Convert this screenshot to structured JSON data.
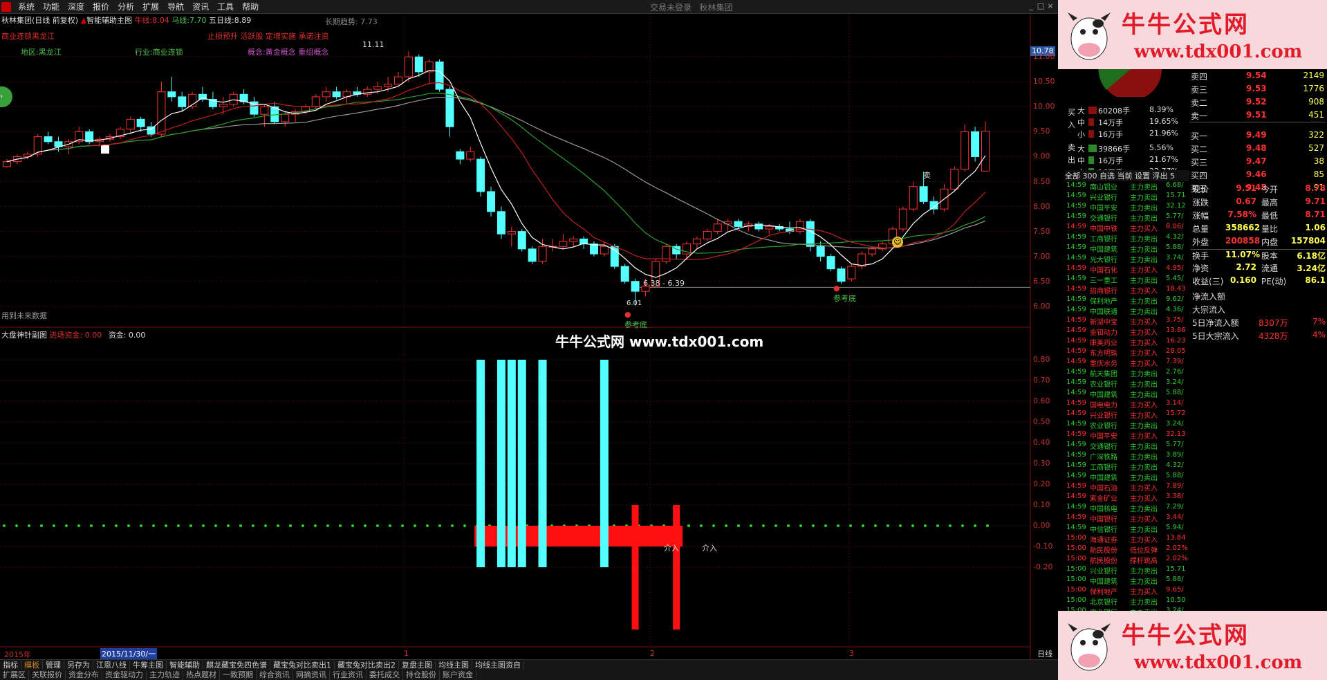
{
  "menu": [
    "系统",
    "功能",
    "深度",
    "报价",
    "分析",
    "扩展",
    "导航",
    "资讯",
    "工具",
    "帮助"
  ],
  "window": {
    "title": "交易未登录",
    "company": "秋林集团"
  },
  "main_header": {
    "stock": "秋林集团(日线 前复权)",
    "indicator": "智能辅助主图",
    "niu_label": "牛线:",
    "niu_val": "8.04",
    "ma_label": "马线:",
    "ma_val": "7.70",
    "wr_label": "五日线:",
    "wr_val": "8.89",
    "trend_label": "长期趋势:",
    "trend_val": "7.73"
  },
  "tags": {
    "line2_left": "商业连锁黑龙江",
    "line2_right": "止损预升 活跃股 定增实施 承诺注资",
    "region": "地区:黑龙江",
    "industry": "行业:商业连锁",
    "concept": "概念:黄金概念 重组概念"
  },
  "annotations": {
    "top": "11.11",
    "low": "6.01",
    "range": "6.38 - 6.39",
    "ref1": "参考底",
    "ref2": "参考底",
    "sell": "卖",
    "future": "用到未来数据",
    "jieru1": "介入",
    "jieru2": "介入"
  },
  "price_axis": [
    "11.00",
    "10.50",
    "10.00",
    "9.50",
    "9.00",
    "8.50",
    "8.00",
    "7.50",
    "7.00",
    "6.50",
    "6.00"
  ],
  "price_tag": "10.78",
  "sub_header": {
    "title": "大盘神针副图",
    "entry": "进场资金: 0.00",
    "fund": "资金: 0.00"
  },
  "sub_axis": [
    "0.80",
    "0.70",
    "0.60",
    "0.50",
    "0.40",
    "0.30",
    "0.20",
    "0.10",
    "0.00",
    "-0.10",
    "-0.20"
  ],
  "date_bar": {
    "year": "2015年",
    "date": "2015/11/30/一",
    "m1": "1",
    "m2": "2",
    "m3": "3",
    "unit": "日线"
  },
  "watermark": "牛牛公式网 www.tdx001.com",
  "ad": {
    "line1": "牛牛公式网",
    "line2": "www.tdx001.com"
  },
  "tabs1": [
    "指标",
    "模板",
    "管理",
    "另存为",
    "江恩八线",
    "牛筹主图",
    "智能辅助",
    "麒龙藏宝免四色谱",
    "藏宝兔对比卖出1",
    "藏宝兔对比卖出2",
    "复盘主图",
    "均线主图",
    "均线主图资自"
  ],
  "tabs2": [
    "扩展区",
    "关联报价",
    "资金分布",
    "资金驱动力",
    "主力轨迹",
    "热点题材",
    "一致预期",
    "综合资讯",
    "网摘资讯",
    "行业资讯",
    "委托成交",
    "持仓股份",
    "账户资金"
  ],
  "orderbook": {
    "sell": [
      {
        "l": "卖四",
        "p": "9.54",
        "v": "2149"
      },
      {
        "l": "卖三",
        "p": "9.53",
        "v": "1776"
      },
      {
        "l": "卖二",
        "p": "9.52",
        "v": "908"
      },
      {
        "l": "卖一",
        "p": "9.51",
        "v": "451"
      }
    ],
    "buy": [
      {
        "l": "买一",
        "p": "9.49",
        "v": "322"
      },
      {
        "l": "买二",
        "p": "9.48",
        "v": "527"
      },
      {
        "l": "买三",
        "p": "9.47",
        "v": "38"
      },
      {
        "l": "买四",
        "p": "9.46",
        "v": "85"
      },
      {
        "l": "买五",
        "p": "9.45",
        "v": "91"
      }
    ]
  },
  "flow": {
    "buy": [
      {
        "s": "大",
        "v": "60208手",
        "p": "8.39%"
      },
      {
        "s": "中",
        "v": "14万手",
        "p": "19.65%"
      },
      {
        "s": "小",
        "v": "16万手",
        "p": "21.96%"
      }
    ],
    "sell": [
      {
        "s": "大",
        "v": "39866手",
        "p": "5.56%"
      },
      {
        "s": "中",
        "v": "16万手",
        "p": "21.67%"
      },
      {
        "s": "小",
        "v": "16万手",
        "p": "22.77%"
      }
    ],
    "buy_lbl": "买 入",
    "sell_lbl": "卖 出",
    "tabs": "全部  300  自选  当前  设置  浮出  5"
  },
  "quote": [
    [
      "现价",
      "9.51",
      "今开",
      "8.78"
    ],
    [
      "涨跌",
      "0.67",
      "最高",
      "9.71"
    ],
    [
      "涨幅",
      "7.58%",
      "最低",
      "8.71"
    ],
    [
      "总量",
      "358662",
      "量比",
      "1.06"
    ],
    [
      "外盘",
      "200858",
      "内盘",
      "157804"
    ],
    [
      "换手",
      "11.07%",
      "股本",
      "6.18亿"
    ],
    [
      "净资",
      "2.72",
      "流通",
      "3.24亿"
    ],
    [
      "收益(三)",
      "0.160",
      "PE(动)",
      "86.1"
    ]
  ],
  "extras": {
    "l1": "净流入额",
    "l2": "大宗流入",
    "l3": "5日净流入额",
    "v3": "8307万",
    "p3": "7%",
    "l4": "5日大宗流入",
    "v4": "4328万",
    "p4": "4%"
  },
  "ticks": [
    [
      "14:59",
      "南山铝业",
      "主力卖出",
      "6.68/",
      "g"
    ],
    [
      "14:59",
      "兴业银行",
      "主力卖出",
      "15.71",
      "g"
    ],
    [
      "14:59",
      "中国平安",
      "主力卖出",
      "32.12",
      "g"
    ],
    [
      "14:59",
      "交通银行",
      "主力卖出",
      "5.77/",
      "g"
    ],
    [
      "14:59",
      "中国中铁",
      "主力买入",
      "8.06/",
      "r"
    ],
    [
      "14:59",
      "工商银行",
      "主力卖出",
      "4.32/",
      "g"
    ],
    [
      "14:59",
      "中国建筑",
      "主力卖出",
      "5.88/",
      "g"
    ],
    [
      "14:59",
      "光大银行",
      "主力卖出",
      "3.74/",
      "g"
    ],
    [
      "14:59",
      "中国石化",
      "主力买入",
      "4.95/",
      "r"
    ],
    [
      "14:59",
      "三一重工",
      "主力卖出",
      "5.45/",
      "g"
    ],
    [
      "14:59",
      "招商银行",
      "主力买入",
      "18.43",
      "r"
    ],
    [
      "14:59",
      "保利地产",
      "主力卖出",
      "9.62/",
      "g"
    ],
    [
      "14:59",
      "中国联通",
      "主力卖出",
      "4.36/",
      "g"
    ],
    [
      "14:59",
      "新湖中宝",
      "主力买入",
      "3.75/",
      "r"
    ],
    [
      "14:59",
      "金钼动力",
      "主力买入",
      "13.86",
      "r"
    ],
    [
      "14:59",
      "康美药业",
      "主力买入",
      "16.23",
      "r"
    ],
    [
      "14:59",
      "东方明珠",
      "主力买入",
      "28.05",
      "r"
    ],
    [
      "14:59",
      "重庆水务",
      "主力买入",
      "7.39/",
      "r"
    ],
    [
      "14:59",
      "航天集团",
      "主力卖出",
      "2.76/",
      "g"
    ],
    [
      "14:59",
      "农业银行",
      "主力卖出",
      "3.24/",
      "g"
    ],
    [
      "14:59",
      "中国建筑",
      "主力卖出",
      "5.88/",
      "g"
    ],
    [
      "14:59",
      "国电电力",
      "主力买入",
      "3.14/",
      "r"
    ],
    [
      "14:59",
      "兴业银行",
      "主力买入",
      "15.72",
      "r"
    ],
    [
      "14:59",
      "农业银行",
      "主力卖出",
      "3.24/",
      "g"
    ],
    [
      "14:59",
      "中国平安",
      "主力买入",
      "32.13",
      "r"
    ],
    [
      "14:59",
      "交通银行",
      "主力卖出",
      "5.77/",
      "g"
    ],
    [
      "14:59",
      "广深铁路",
      "主力卖出",
      "3.89/",
      "g"
    ],
    [
      "14:59",
      "工商银行",
      "主力卖出",
      "4.32/",
      "g"
    ],
    [
      "14:59",
      "中国建筑",
      "主力卖出",
      "5.88/",
      "g"
    ],
    [
      "14:59",
      "中国石油",
      "主力买入",
      "7.89/",
      "r"
    ],
    [
      "14:59",
      "紫金矿业",
      "主力买入",
      "3.38/",
      "r"
    ],
    [
      "14:59",
      "中国核电",
      "主力卖出",
      "7.29/",
      "g"
    ],
    [
      "14:59",
      "中国银行",
      "主力买入",
      "3.44/",
      "r"
    ],
    [
      "14:59",
      "中信银行",
      "主力卖出",
      "5.94/",
      "g"
    ],
    [
      "15:00",
      "海通证券",
      "主力买入",
      "13.84",
      "r"
    ],
    [
      "15:00",
      "航民股份",
      "低位反弹",
      "2.02%",
      "r"
    ],
    [
      "15:00",
      "航民股份",
      "撑杆跳高",
      "2.02%",
      "r"
    ],
    [
      "15:00",
      "兴业银行",
      "主力卖出",
      "15.71",
      "g"
    ],
    [
      "15:00",
      "中国建筑",
      "主力卖出",
      "5.88/",
      "g"
    ],
    [
      "15:00",
      "保利地产",
      "主力买入",
      "9.65/",
      "r"
    ],
    [
      "15:00",
      "北京银行",
      "主力卖出",
      "10.50",
      "g"
    ],
    [
      "15:00",
      "农业银行",
      "主力卖出",
      "3.24/",
      "g"
    ]
  ],
  "chart_data": {
    "type": "candlestick",
    "x": [
      "2015-11-30",
      "2016-01",
      "2016-02",
      "2016-03"
    ],
    "ohlc": [
      [
        8.8,
        8.95,
        8.78,
        8.9
      ],
      [
        8.9,
        9.05,
        8.85,
        9.0
      ],
      [
        9.0,
        9.1,
        8.95,
        9.05
      ],
      [
        9.05,
        9.45,
        9.0,
        9.4
      ],
      [
        9.4,
        9.5,
        9.25,
        9.3
      ],
      [
        9.3,
        9.4,
        9.1,
        9.2
      ],
      [
        9.2,
        9.35,
        9.05,
        9.3
      ],
      [
        9.3,
        9.6,
        9.25,
        9.5
      ],
      [
        9.5,
        9.55,
        9.25,
        9.3
      ],
      [
        9.3,
        9.4,
        9.2,
        9.35
      ],
      [
        9.35,
        9.45,
        9.3,
        9.4
      ],
      [
        9.4,
        9.6,
        9.35,
        9.55
      ],
      [
        9.55,
        9.8,
        9.45,
        9.75
      ],
      [
        9.75,
        9.8,
        9.5,
        9.6
      ],
      [
        9.6,
        9.7,
        9.4,
        9.45
      ],
      [
        9.45,
        10.5,
        9.4,
        10.3
      ],
      [
        10.3,
        10.6,
        10.1,
        10.2
      ],
      [
        10.2,
        10.3,
        9.9,
        10.0
      ],
      [
        10.0,
        10.3,
        9.95,
        10.25
      ],
      [
        10.25,
        10.4,
        10.1,
        10.15
      ],
      [
        10.15,
        10.3,
        9.95,
        10.0
      ],
      [
        10.0,
        10.2,
        9.85,
        10.05
      ],
      [
        10.05,
        10.3,
        10.0,
        10.25
      ],
      [
        10.25,
        10.35,
        10.05,
        10.1
      ],
      [
        10.1,
        10.2,
        9.8,
        9.85
      ],
      [
        9.85,
        10.05,
        9.6,
        10.0
      ],
      [
        10.0,
        10.1,
        9.65,
        9.7
      ],
      [
        9.7,
        9.9,
        9.6,
        9.85
      ],
      [
        9.85,
        9.95,
        9.7,
        9.9
      ],
      [
        9.9,
        10.05,
        9.85,
        10.0
      ],
      [
        10.0,
        10.25,
        9.95,
        10.2
      ],
      [
        10.2,
        10.4,
        10.1,
        10.3
      ],
      [
        10.3,
        10.4,
        10.15,
        10.2
      ],
      [
        10.2,
        10.35,
        10.05,
        10.3
      ],
      [
        10.3,
        10.4,
        10.2,
        10.25
      ],
      [
        10.25,
        10.4,
        10.2,
        10.35
      ],
      [
        10.35,
        10.5,
        10.25,
        10.4
      ],
      [
        10.4,
        10.6,
        10.3,
        10.45
      ],
      [
        10.45,
        10.7,
        10.4,
        10.6
      ],
      [
        10.6,
        11.11,
        10.5,
        11.0
      ],
      [
        11.0,
        11.05,
        10.6,
        10.7
      ],
      [
        10.7,
        10.95,
        10.45,
        10.9
      ],
      [
        10.9,
        10.95,
        10.3,
        10.35
      ],
      [
        10.35,
        10.4,
        9.4,
        9.6
      ],
      [
        9.1,
        9.15,
        8.85,
        8.95
      ],
      [
        8.95,
        9.2,
        8.9,
        9.1
      ],
      [
        8.95,
        9.0,
        8.2,
        8.3
      ],
      [
        8.3,
        8.4,
        7.8,
        7.9
      ],
      [
        7.9,
        8.0,
        7.35,
        7.45
      ],
      [
        7.45,
        7.6,
        7.2,
        7.5
      ],
      [
        7.5,
        7.55,
        7.1,
        7.15
      ],
      [
        7.15,
        7.2,
        6.85,
        6.9
      ],
      [
        6.9,
        7.35,
        6.85,
        7.2
      ],
      [
        7.2,
        7.35,
        7.1,
        7.2
      ],
      [
        7.2,
        7.45,
        7.15,
        7.3
      ],
      [
        7.3,
        7.4,
        7.2,
        7.35
      ],
      [
        7.35,
        7.4,
        7.15,
        7.25
      ],
      [
        7.25,
        7.3,
        7.0,
        7.05
      ],
      [
        7.05,
        7.3,
        7.0,
        7.2
      ],
      [
        7.2,
        7.25,
        6.75,
        6.8
      ],
      [
        6.8,
        6.85,
        6.45,
        6.5
      ],
      [
        6.5,
        6.55,
        6.01,
        6.3
      ],
      [
        6.3,
        6.55,
        6.2,
        6.4
      ],
      [
        6.4,
        6.95,
        6.38,
        6.9
      ],
      [
        6.9,
        7.25,
        6.85,
        7.2
      ],
      [
        7.2,
        7.25,
        6.95,
        7.05
      ],
      [
        7.05,
        7.3,
        6.95,
        7.25
      ],
      [
        7.25,
        7.4,
        7.15,
        7.35
      ],
      [
        7.35,
        7.55,
        7.3,
        7.5
      ],
      [
        7.5,
        7.75,
        7.45,
        7.65
      ],
      [
        7.65,
        7.75,
        7.5,
        7.7
      ],
      [
        7.7,
        7.75,
        7.55,
        7.6
      ],
      [
        7.6,
        7.7,
        7.5,
        7.65
      ],
      [
        7.65,
        7.7,
        7.5,
        7.55
      ],
      [
        7.55,
        7.65,
        7.45,
        7.6
      ],
      [
        7.6,
        7.65,
        7.5,
        7.55
      ],
      [
        7.55,
        7.7,
        7.45,
        7.5
      ],
      [
        7.5,
        7.75,
        7.45,
        7.7
      ],
      [
        7.7,
        7.75,
        7.1,
        7.2
      ],
      [
        7.2,
        7.3,
        6.9,
        7.0
      ],
      [
        7.0,
        7.05,
        6.7,
        6.75
      ],
      [
        6.75,
        6.8,
        6.45,
        6.5
      ],
      [
        6.55,
        6.85,
        6.5,
        6.8
      ],
      [
        6.8,
        7.1,
        6.75,
        7.05
      ],
      [
        7.05,
        7.2,
        7.0,
        7.15
      ],
      [
        7.15,
        7.3,
        7.1,
        7.25
      ],
      [
        7.25,
        7.6,
        7.2,
        7.55
      ],
      [
        7.55,
        8.0,
        7.5,
        7.95
      ],
      [
        7.95,
        8.5,
        7.9,
        8.4
      ],
      [
        8.4,
        8.7,
        8.05,
        8.1
      ],
      [
        8.1,
        8.2,
        7.85,
        7.95
      ],
      [
        7.95,
        8.45,
        7.9,
        8.35
      ],
      [
        8.35,
        8.8,
        8.3,
        8.75
      ],
      [
        8.75,
        9.65,
        8.7,
        9.5
      ],
      [
        9.5,
        9.6,
        8.9,
        9.0
      ],
      [
        8.71,
        9.71,
        8.71,
        9.51
      ]
    ],
    "sub_series": {
      "cyan_bar_positions": [
        46,
        48,
        49,
        50,
        52,
        58
      ],
      "red_bar_positions": [
        46,
        47,
        48,
        49,
        50,
        51,
        52,
        53,
        54,
        55,
        56,
        57,
        58,
        59,
        60,
        61,
        62,
        63,
        64,
        65
      ],
      "red_spike_positions": [
        61,
        65
      ],
      "cyan_bar_value": 0.8,
      "cyan_bar_bottom": -0.2,
      "red_block_range": [
        0.0,
        -0.1
      ],
      "red_spike_range": [
        0.1,
        -0.5
      ]
    }
  }
}
